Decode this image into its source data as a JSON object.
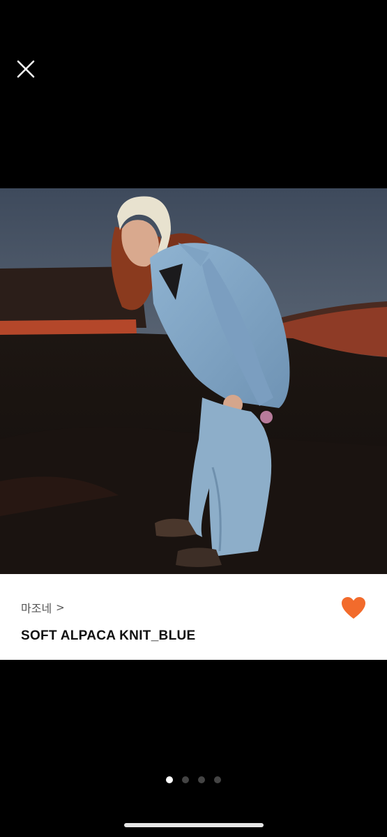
{
  "product": {
    "brand": "마조네",
    "brand_chevron": ">",
    "name": "SOFT ALPACA KNIT_BLUE",
    "liked": true
  },
  "icons": {
    "close": "close-icon",
    "heart": "heart-icon",
    "brand_chevron": "chevron-right-icon"
  },
  "colors": {
    "background": "#000000",
    "info_panel": "#ffffff",
    "heart": "#f26b2c",
    "dot_active": "#ffffff",
    "dot_inactive": "#444444"
  },
  "gallery": {
    "page_count": 4,
    "active_index": 1
  }
}
